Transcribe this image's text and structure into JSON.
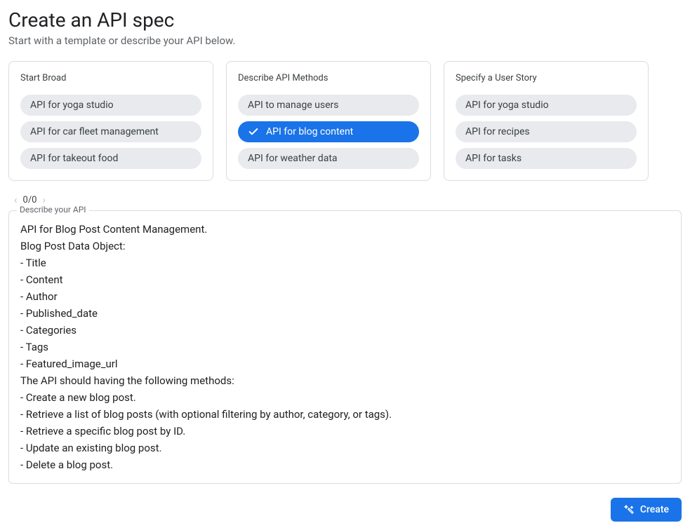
{
  "header": {
    "title": "Create an API spec",
    "subtitle": "Start with a template or describe your API below."
  },
  "cards": [
    {
      "title": "Start Broad",
      "chips": [
        {
          "label": "API for yoga studio",
          "selected": false
        },
        {
          "label": "API for car fleet management",
          "selected": false
        },
        {
          "label": "API for takeout food",
          "selected": false
        }
      ]
    },
    {
      "title": "Describe API Methods",
      "chips": [
        {
          "label": "API to manage users",
          "selected": false
        },
        {
          "label": "API for blog content",
          "selected": true
        },
        {
          "label": "API for weather data",
          "selected": false
        }
      ]
    },
    {
      "title": "Specify a User Story",
      "chips": [
        {
          "label": "API for yoga studio",
          "selected": false
        },
        {
          "label": "API for recipes",
          "selected": false
        },
        {
          "label": "API for tasks",
          "selected": false
        }
      ]
    }
  ],
  "nav": {
    "counter": "0/0"
  },
  "textarea": {
    "label": "Describe your API",
    "value": "API for Blog Post Content Management.\nBlog Post Data Object:\n- Title\n- Content\n- Author\n- Published_date\n- Categories\n- Tags\n- Featured_image_url\nThe API should having the following methods:\n- Create a new blog post.\n- Retrieve a list of blog posts (with optional filtering by author, category, or tags).\n- Retrieve a specific blog post by ID.\n- Update an existing blog post.\n- Delete a blog post."
  },
  "footer": {
    "create_label": "Create"
  }
}
